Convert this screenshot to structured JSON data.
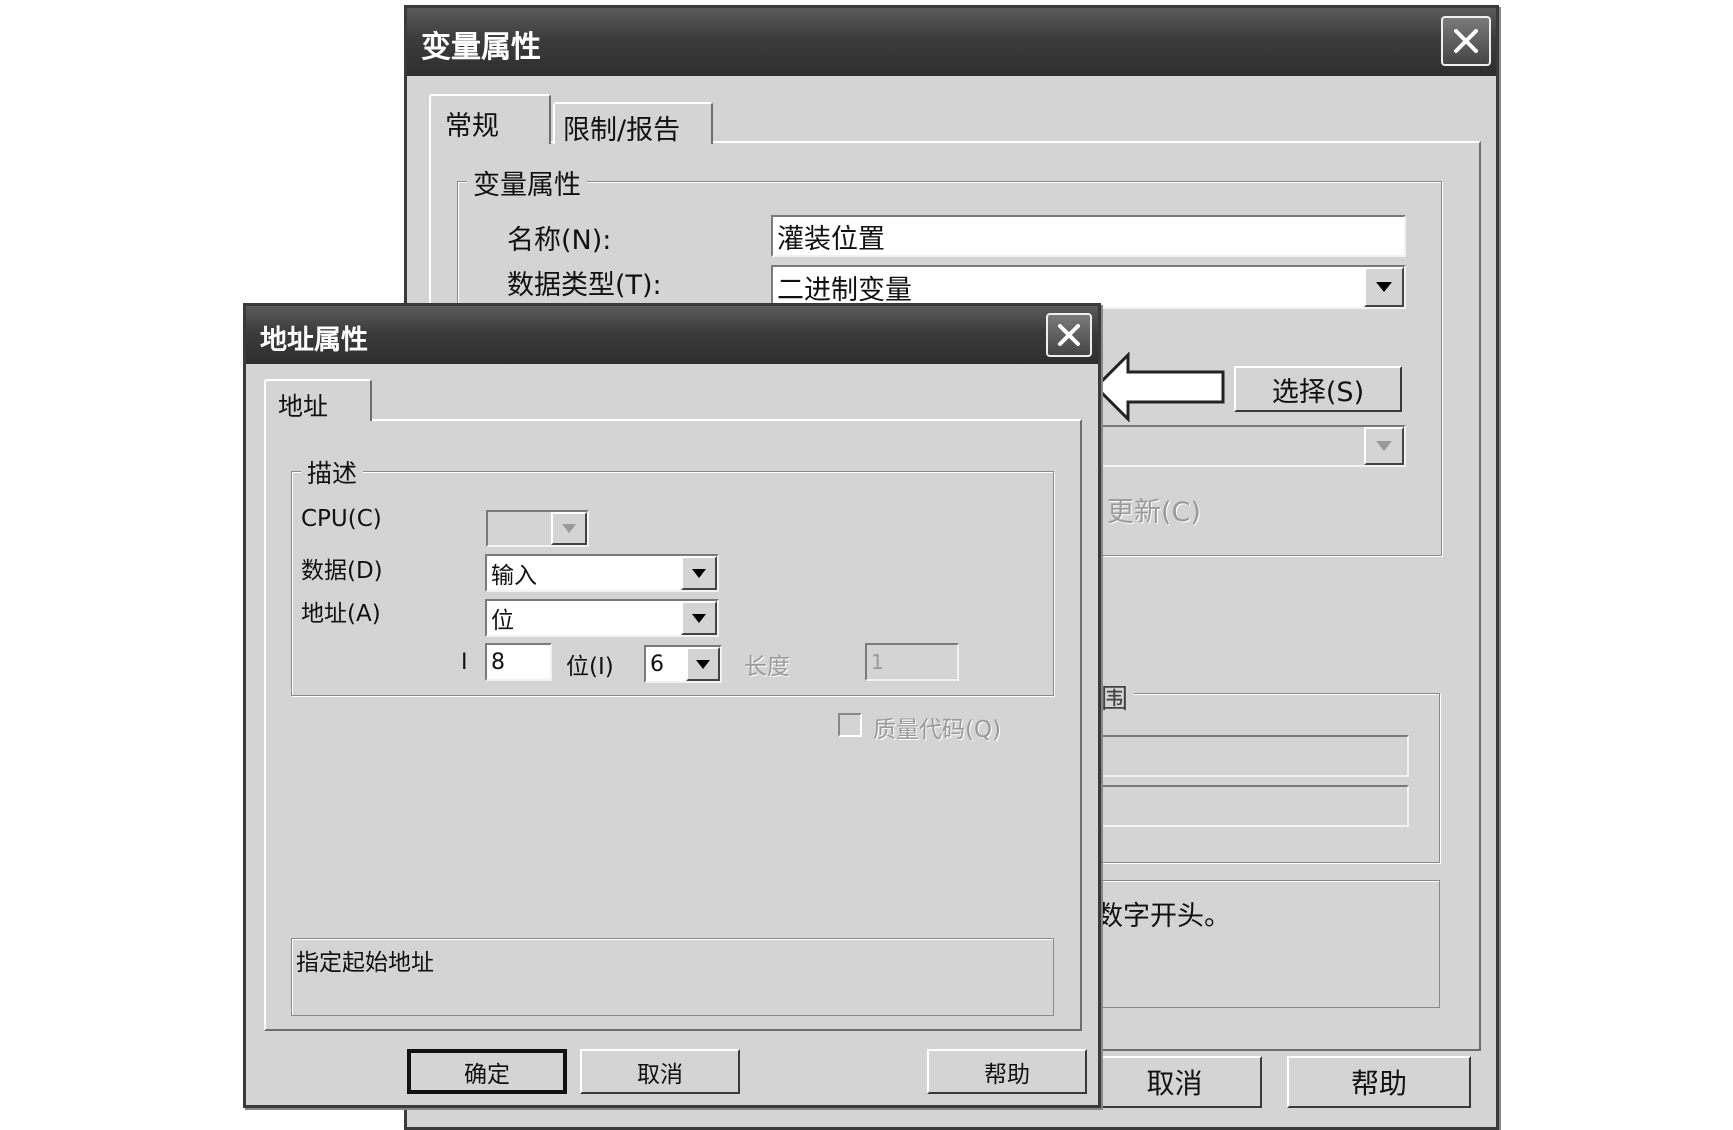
{
  "variable_dialog": {
    "title": "变量属性",
    "tabs": [
      "常规",
      "限制/报告"
    ],
    "group_title": "变量属性",
    "name_label": "名称(N):",
    "name_value": "灌装位置",
    "type_label": "数据类型(T):",
    "type_value": "二进制变量",
    "select_button": "选择(S)",
    "update_label": "更新(C)",
    "range_fragment": "围",
    "hint_fragment": "数字开头。",
    "cancel_button": "取消",
    "help_button": "帮助"
  },
  "address_dialog": {
    "title": "地址属性",
    "tab": "地址",
    "group_title": "描述",
    "cpu_label": "CPU(C)",
    "cpu_value": "",
    "data_label": "数据(D)",
    "data_value": "输入",
    "address_label": "地址(A)",
    "address_value": "位",
    "i_label": "I",
    "i_value": "8",
    "bit_label": "位(I)",
    "bit_value": "6",
    "length_label": "长度",
    "length_value": "1",
    "quality_code_label": "质量代码(Q)",
    "hint_text": "指定起始地址",
    "ok_button": "确定",
    "cancel_button": "取消",
    "help_button": "帮助"
  }
}
